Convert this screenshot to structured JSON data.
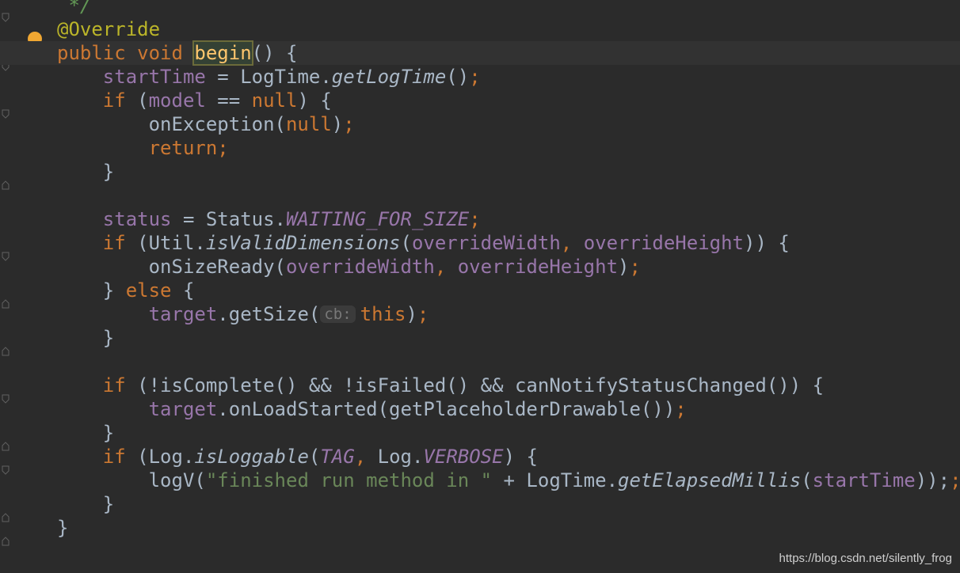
{
  "editor": {
    "comment_end": "*/",
    "annotation": "@Override",
    "kw_public": "public",
    "kw_void": "void",
    "method_name": "begin",
    "params_open": "() {",
    "startTime": "startTime",
    "eq": " = ",
    "LogTime": "LogTime.",
    "getLogTime": "getLogTime",
    "call_end": "();",
    "kw_if": "if",
    "model": "model",
    "eqeq_null": " == ",
    "null": "null",
    "close_paren_brace": ") {",
    "onException": "onException(",
    "semicolon": ");",
    "kw_return": "return",
    "semi": ";",
    "close_brace": "}",
    "status": "status",
    "StatusDot": "Status.",
    "WAITING_FOR_SIZE": "WAITING_FOR_SIZE",
    "UtilDot": "(Util.",
    "isValidDimensions": "isValidDimensions",
    "overrideWidth": "overrideWidth",
    "comma": ", ",
    "overrideHeight": "overrideHeight",
    "close_if": ")) {",
    "onSizeReady": "onSizeReady(",
    "close_call": ");",
    "else_open": "} ",
    "kw_else": "else",
    "brace_open": " {",
    "target": "target",
    "getSize": ".getSize(",
    "hint_cb": "cb:",
    "kw_this": "this",
    "isComplete_line": " (!isComplete() && !isFailed() && canNotifyStatusChanged()) {",
    "onLoadStarted": ".onLoadStarted(getPlaceholderDrawable())",
    "LogDot": " (Log.",
    "isLoggable": "isLoggable",
    "TAG": "TAG",
    "LogDot2": "Log.",
    "VERBOSE": "VERBOSE",
    "logV": "logV(",
    "string": "\"finished run method in \"",
    "plus": " + LogTime.",
    "getElapsedMillis": "getElapsedMillis",
    "final_close": "));",
    "open_paren": "(",
    "close_paren": ")",
    "space": " "
  },
  "watermark": "https://blog.csdn.net/silently_frog"
}
